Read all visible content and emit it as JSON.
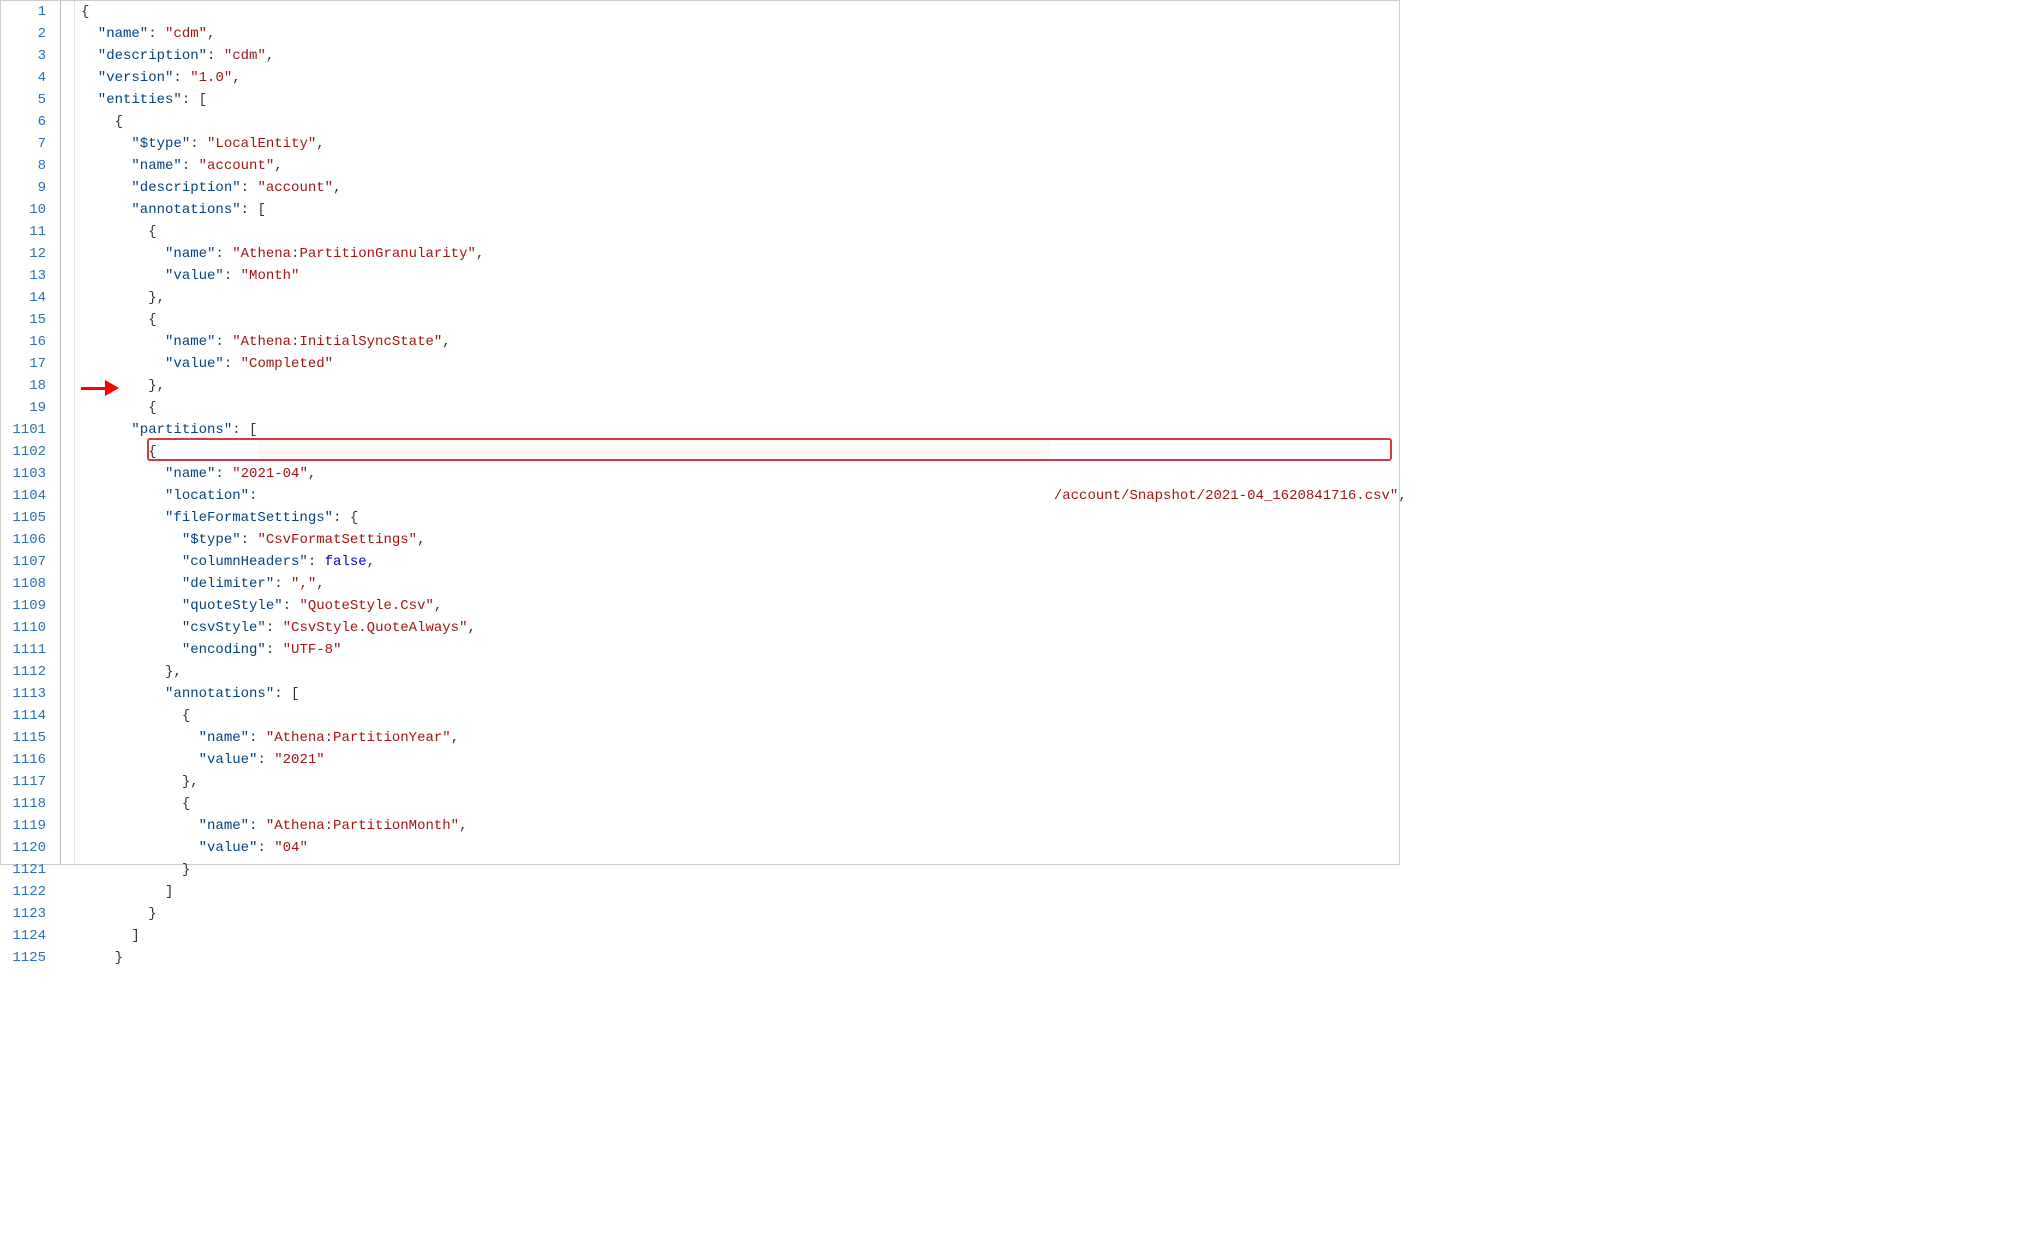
{
  "lines": [
    {
      "num": "1",
      "tokens": [
        {
          "t": "{",
          "c": "punc",
          "ind": 0
        }
      ]
    },
    {
      "num": "2",
      "tokens": [
        {
          "t": "\"name\"",
          "c": "key",
          "ind": 1
        },
        {
          "t": ": ",
          "c": "punc"
        },
        {
          "t": "\"cdm\"",
          "c": "str"
        },
        {
          "t": ",",
          "c": "punc"
        }
      ]
    },
    {
      "num": "3",
      "tokens": [
        {
          "t": "\"description\"",
          "c": "key",
          "ind": 1
        },
        {
          "t": ": ",
          "c": "punc"
        },
        {
          "t": "\"cdm\"",
          "c": "str"
        },
        {
          "t": ",",
          "c": "punc"
        }
      ]
    },
    {
      "num": "4",
      "tokens": [
        {
          "t": "\"version\"",
          "c": "key",
          "ind": 1
        },
        {
          "t": ": ",
          "c": "punc"
        },
        {
          "t": "\"1.0\"",
          "c": "str"
        },
        {
          "t": ",",
          "c": "punc"
        }
      ]
    },
    {
      "num": "5",
      "tokens": [
        {
          "t": "\"entities\"",
          "c": "key",
          "ind": 1
        },
        {
          "t": ": [",
          "c": "punc"
        }
      ]
    },
    {
      "num": "6",
      "tokens": [
        {
          "t": "{",
          "c": "punc",
          "ind": 2
        }
      ]
    },
    {
      "num": "7",
      "tokens": [
        {
          "t": "\"$type\"",
          "c": "key",
          "ind": 3
        },
        {
          "t": ": ",
          "c": "punc"
        },
        {
          "t": "\"LocalEntity\"",
          "c": "str"
        },
        {
          "t": ",",
          "c": "punc"
        }
      ]
    },
    {
      "num": "8",
      "tokens": [
        {
          "t": "\"name\"",
          "c": "key",
          "ind": 3
        },
        {
          "t": ": ",
          "c": "punc"
        },
        {
          "t": "\"account\"",
          "c": "str"
        },
        {
          "t": ",",
          "c": "punc"
        }
      ]
    },
    {
      "num": "9",
      "tokens": [
        {
          "t": "\"description\"",
          "c": "key",
          "ind": 3
        },
        {
          "t": ": ",
          "c": "punc"
        },
        {
          "t": "\"account\"",
          "c": "str"
        },
        {
          "t": ",",
          "c": "punc"
        }
      ]
    },
    {
      "num": "10",
      "tokens": [
        {
          "t": "\"annotations\"",
          "c": "key",
          "ind": 3
        },
        {
          "t": ": [",
          "c": "punc"
        }
      ]
    },
    {
      "num": "11",
      "tokens": [
        {
          "t": "{",
          "c": "punc",
          "ind": 4
        }
      ]
    },
    {
      "num": "12",
      "tokens": [
        {
          "t": "\"name\"",
          "c": "key",
          "ind": 5
        },
        {
          "t": ": ",
          "c": "punc"
        },
        {
          "t": "\"Athena:PartitionGranularity\"",
          "c": "str"
        },
        {
          "t": ",",
          "c": "punc"
        }
      ]
    },
    {
      "num": "13",
      "tokens": [
        {
          "t": "\"value\"",
          "c": "key",
          "ind": 5
        },
        {
          "t": ": ",
          "c": "punc"
        },
        {
          "t": "\"Month\"",
          "c": "str"
        }
      ]
    },
    {
      "num": "14",
      "tokens": [
        {
          "t": "},",
          "c": "punc",
          "ind": 4
        }
      ]
    },
    {
      "num": "15",
      "tokens": [
        {
          "t": "{",
          "c": "punc",
          "ind": 4
        }
      ]
    },
    {
      "num": "16",
      "tokens": [
        {
          "t": "\"name\"",
          "c": "key",
          "ind": 5
        },
        {
          "t": ": ",
          "c": "punc"
        },
        {
          "t": "\"Athena:InitialSyncState\"",
          "c": "str"
        },
        {
          "t": ",",
          "c": "punc"
        }
      ]
    },
    {
      "num": "17",
      "tokens": [
        {
          "t": "\"value\"",
          "c": "key",
          "ind": 5
        },
        {
          "t": ": ",
          "c": "punc"
        },
        {
          "t": "\"Completed\"",
          "c": "str"
        }
      ]
    },
    {
      "num": "18",
      "tokens": [
        {
          "t": "},",
          "c": "punc",
          "ind": 4
        }
      ]
    },
    {
      "num": "19",
      "tokens": [
        {
          "t": "{",
          "c": "punc",
          "ind": 4
        }
      ]
    },
    {
      "num": "1101",
      "tokens": [
        {
          "t": "\"partitions\"",
          "c": "key",
          "ind": 3
        },
        {
          "t": ": [",
          "c": "punc"
        }
      ]
    },
    {
      "num": "1102",
      "tokens": [
        {
          "t": "{",
          "c": "punc",
          "ind": 4
        }
      ]
    },
    {
      "num": "1103",
      "tokens": [
        {
          "t": "\"name\"",
          "c": "key",
          "ind": 5
        },
        {
          "t": ": ",
          "c": "punc"
        },
        {
          "t": "\"2021-04\"",
          "c": "str"
        },
        {
          "t": ",",
          "c": "punc"
        }
      ]
    },
    {
      "num": "1104",
      "tokens": [
        {
          "t": "\"location\"",
          "c": "key",
          "ind": 5
        },
        {
          "t": ": ",
          "c": "punc"
        },
        {
          "t": "",
          "c": ""
        },
        {
          "t": "/account/Snapshot/2021-04_1620841716.csv\"",
          "c": "str",
          "rightpad": true
        },
        {
          "t": ",",
          "c": "punc"
        }
      ]
    },
    {
      "num": "1105",
      "tokens": [
        {
          "t": "\"fileFormatSettings\"",
          "c": "key",
          "ind": 5
        },
        {
          "t": ": {",
          "c": "punc"
        }
      ]
    },
    {
      "num": "1106",
      "tokens": [
        {
          "t": "\"$type\"",
          "c": "key",
          "ind": 6
        },
        {
          "t": ": ",
          "c": "punc"
        },
        {
          "t": "\"CsvFormatSettings\"",
          "c": "str"
        },
        {
          "t": ",",
          "c": "punc"
        }
      ]
    },
    {
      "num": "1107",
      "tokens": [
        {
          "t": "\"columnHeaders\"",
          "c": "key",
          "ind": 6
        },
        {
          "t": ": ",
          "c": "punc"
        },
        {
          "t": "false",
          "c": "kw"
        },
        {
          "t": ",",
          "c": "punc"
        }
      ]
    },
    {
      "num": "1108",
      "tokens": [
        {
          "t": "\"delimiter\"",
          "c": "key",
          "ind": 6
        },
        {
          "t": ": ",
          "c": "punc"
        },
        {
          "t": "\",\"",
          "c": "str"
        },
        {
          "t": ",",
          "c": "punc"
        }
      ]
    },
    {
      "num": "1109",
      "tokens": [
        {
          "t": "\"quoteStyle\"",
          "c": "key",
          "ind": 6
        },
        {
          "t": ": ",
          "c": "punc"
        },
        {
          "t": "\"QuoteStyle.Csv\"",
          "c": "str"
        },
        {
          "t": ",",
          "c": "punc"
        }
      ]
    },
    {
      "num": "1110",
      "tokens": [
        {
          "t": "\"csvStyle\"",
          "c": "key",
          "ind": 6
        },
        {
          "t": ": ",
          "c": "punc"
        },
        {
          "t": "\"CsvStyle.QuoteAlways\"",
          "c": "str"
        },
        {
          "t": ",",
          "c": "punc"
        }
      ]
    },
    {
      "num": "1111",
      "tokens": [
        {
          "t": "\"encoding\"",
          "c": "key",
          "ind": 6
        },
        {
          "t": ": ",
          "c": "punc"
        },
        {
          "t": "\"UTF-8\"",
          "c": "str"
        }
      ]
    },
    {
      "num": "1112",
      "tokens": [
        {
          "t": "},",
          "c": "punc",
          "ind": 5
        }
      ]
    },
    {
      "num": "1113",
      "tokens": [
        {
          "t": "\"annotations\"",
          "c": "key",
          "ind": 5
        },
        {
          "t": ": [",
          "c": "punc"
        }
      ]
    },
    {
      "num": "1114",
      "tokens": [
        {
          "t": "{",
          "c": "punc",
          "ind": 6
        }
      ]
    },
    {
      "num": "1115",
      "tokens": [
        {
          "t": "\"name\"",
          "c": "key",
          "ind": 7
        },
        {
          "t": ": ",
          "c": "punc"
        },
        {
          "t": "\"Athena:PartitionYear\"",
          "c": "str"
        },
        {
          "t": ",",
          "c": "punc"
        }
      ]
    },
    {
      "num": "1116",
      "tokens": [
        {
          "t": "\"value\"",
          "c": "key",
          "ind": 7
        },
        {
          "t": ": ",
          "c": "punc"
        },
        {
          "t": "\"2021\"",
          "c": "str"
        }
      ]
    },
    {
      "num": "1117",
      "tokens": [
        {
          "t": "},",
          "c": "punc",
          "ind": 6
        }
      ]
    },
    {
      "num": "1118",
      "tokens": [
        {
          "t": "{",
          "c": "punc",
          "ind": 6
        }
      ]
    },
    {
      "num": "1119",
      "tokens": [
        {
          "t": "\"name\"",
          "c": "key",
          "ind": 7
        },
        {
          "t": ": ",
          "c": "punc"
        },
        {
          "t": "\"Athena:PartitionMonth\"",
          "c": "str"
        },
        {
          "t": ",",
          "c": "punc"
        }
      ]
    },
    {
      "num": "1120",
      "tokens": [
        {
          "t": "\"value\"",
          "c": "key",
          "ind": 7
        },
        {
          "t": ": ",
          "c": "punc"
        },
        {
          "t": "\"04\"",
          "c": "str"
        }
      ]
    },
    {
      "num": "1121",
      "tokens": [
        {
          "t": "}",
          "c": "punc",
          "ind": 6
        }
      ]
    },
    {
      "num": "1122",
      "tokens": [
        {
          "t": "]",
          "c": "punc",
          "ind": 5
        }
      ]
    },
    {
      "num": "1123",
      "tokens": [
        {
          "t": "}",
          "c": "punc",
          "ind": 4
        }
      ]
    },
    {
      "num": "1124",
      "tokens": [
        {
          "t": "]",
          "c": "punc",
          "ind": 3
        }
      ]
    },
    {
      "num": "1125",
      "tokens": [
        {
          "t": "}",
          "c": "punc",
          "ind": 2
        }
      ]
    }
  ],
  "indent_unit": "  ",
  "location_line_index": 22,
  "visible_location_suffix": "/account/Snapshot/2021-04_1620841716.csv"
}
